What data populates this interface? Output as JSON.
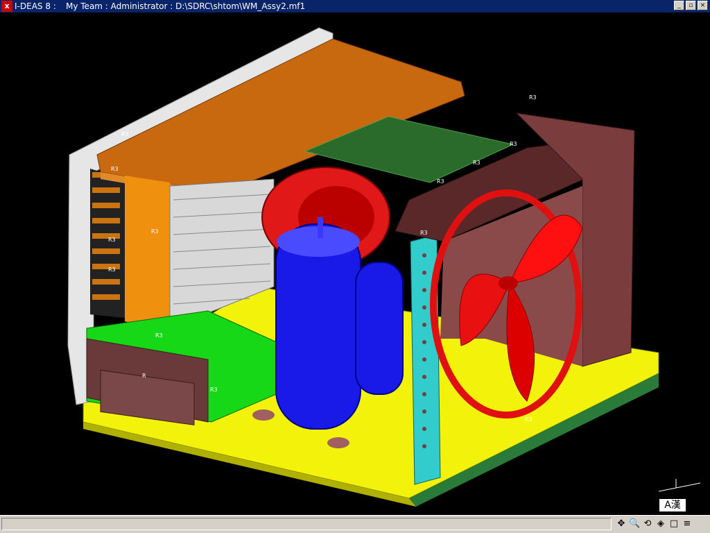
{
  "window": {
    "app_icon": "x",
    "app_name": "I-DEAS 8 :",
    "path": "My Team : Administrator : D:\\SDRC\\shtom\\WM_Assy2.mf1",
    "buttons": {
      "minimize": "_",
      "restore": "▫",
      "close": "×"
    }
  },
  "model_labels": [
    "R3",
    "R3",
    "R3",
    "R3",
    "R3",
    "R3",
    "R3",
    "R3",
    "R3",
    "R3",
    "R",
    "R3",
    "R3",
    "R3"
  ],
  "ime_indicator": "A漢",
  "statusbar": {
    "message": "",
    "tools": [
      {
        "name": "pan-icon",
        "glyph": "✥"
      },
      {
        "name": "zoom-icon",
        "glyph": "🔍"
      },
      {
        "name": "rotate-icon",
        "glyph": "⟲"
      },
      {
        "name": "view-icon",
        "glyph": "◈"
      },
      {
        "name": "square-icon",
        "glyph": "□"
      },
      {
        "name": "menu-lines-icon",
        "glyph": "≡"
      }
    ]
  },
  "colors": {
    "title_bar": "#0a246a",
    "housing_white": "#e6e6e6",
    "top_cover": "#c9690f",
    "base": "#f2f20a",
    "compressor": "#1a1ae8",
    "fan": "#e01010",
    "shroud": "#7a3c3c",
    "pcb": "#16d816",
    "bracket": "#33cccc"
  }
}
